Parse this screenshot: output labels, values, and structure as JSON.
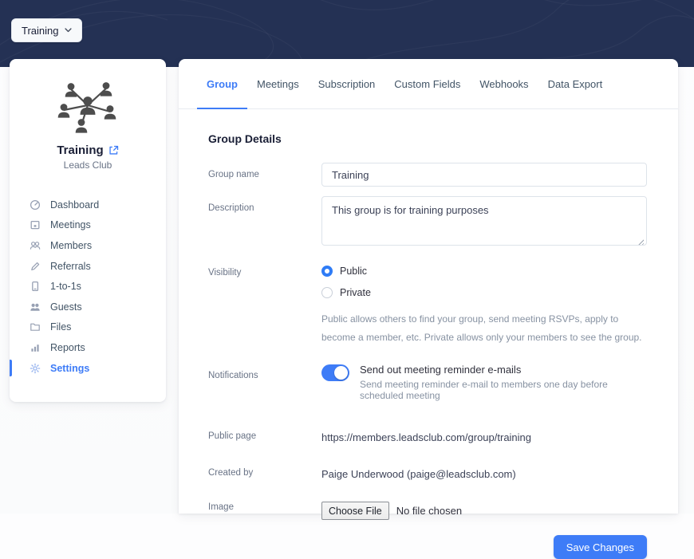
{
  "colors": {
    "navy": "#243154",
    "accent": "#3e7cf7",
    "label_gray": "#697386",
    "help_gray": "#8792a2"
  },
  "top": {
    "group_switcher": {
      "label": "Training",
      "icon": "chevron-down-icon"
    }
  },
  "sidebar": {
    "emblem_icon": "people-network-icon",
    "group_name": "Training",
    "open_icon": "external-link-icon",
    "org_name": "Leads Club",
    "items": [
      {
        "label": "Dashboard",
        "icon": "gauge-icon",
        "active": false
      },
      {
        "label": "Meetings",
        "icon": "calendar-icon",
        "active": false
      },
      {
        "label": "Members",
        "icon": "members-icon",
        "active": false
      },
      {
        "label": "Referrals",
        "icon": "pencil-icon",
        "active": false
      },
      {
        "label": "1-to-1s",
        "icon": "one-to-one-icon",
        "active": false
      },
      {
        "label": "Guests",
        "icon": "guests-icon",
        "active": false
      },
      {
        "label": "Files",
        "icon": "folder-icon",
        "active": false
      },
      {
        "label": "Reports",
        "icon": "bar-chart-icon",
        "active": false
      },
      {
        "label": "Settings",
        "icon": "gear-icon",
        "active": true
      }
    ]
  },
  "main": {
    "tabs": [
      {
        "label": "Group",
        "active": true
      },
      {
        "label": "Meetings",
        "active": false
      },
      {
        "label": "Subscription",
        "active": false
      },
      {
        "label": "Custom Fields",
        "active": false
      },
      {
        "label": "Webhooks",
        "active": false
      },
      {
        "label": "Data Export",
        "active": false
      }
    ],
    "section_title": "Group Details",
    "form": {
      "group_name": {
        "label": "Group name",
        "value": "Training"
      },
      "description": {
        "label": "Description",
        "value": "This group is for training purposes"
      },
      "visibility": {
        "label": "Visibility",
        "options": [
          {
            "label": "Public",
            "selected": true
          },
          {
            "label": "Private",
            "selected": false
          }
        ],
        "help": "Public allows others to find your group, send meeting RSVPs, apply to become a member, etc. Private allows only your members to see the group."
      },
      "notifications": {
        "label": "Notifications",
        "toggle_on": true,
        "toggle_label": "Send out meeting reminder e-mails",
        "help": "Send meeting reminder e-mail to members one day before scheduled meeting"
      },
      "public_page": {
        "label": "Public page",
        "value": "https://members.leadsclub.com/group/training"
      },
      "created_by": {
        "label": "Created by",
        "value": "Paige Underwood (paige@leadsclub.com)"
      },
      "image": {
        "label": "Image",
        "button_label": "Choose File",
        "status": "No file chosen"
      }
    },
    "save_label": "Save Changes"
  }
}
